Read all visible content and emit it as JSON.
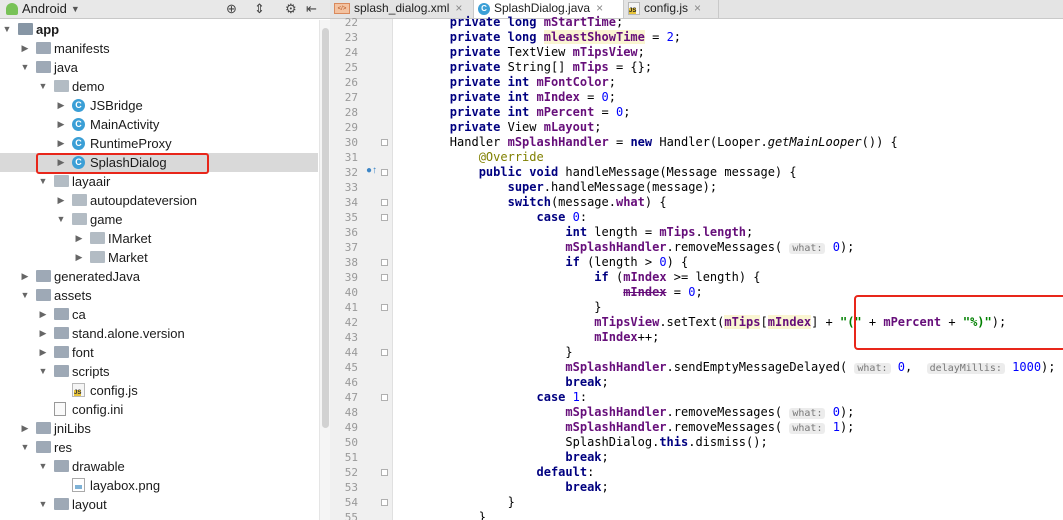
{
  "project_panel": {
    "view_selector": "Android",
    "tree": [
      {
        "label": "app",
        "depth": 0,
        "icon": "module-folder",
        "expanded": true,
        "bold": true
      },
      {
        "label": "manifests",
        "depth": 1,
        "icon": "folder",
        "expanded": false
      },
      {
        "label": "java",
        "depth": 1,
        "icon": "folder",
        "expanded": true
      },
      {
        "label": "demo",
        "depth": 2,
        "icon": "package",
        "expanded": true
      },
      {
        "label": "JSBridge",
        "depth": 3,
        "icon": "class",
        "expanded": false
      },
      {
        "label": "MainActivity",
        "depth": 3,
        "icon": "class",
        "expanded": false
      },
      {
        "label": "RuntimeProxy",
        "depth": 3,
        "icon": "class",
        "expanded": false
      },
      {
        "label": "SplashDialog",
        "depth": 3,
        "icon": "class",
        "expanded": false,
        "selected": true
      },
      {
        "label": "layaair",
        "depth": 2,
        "icon": "package",
        "expanded": true
      },
      {
        "label": "autoupdateversion",
        "depth": 3,
        "icon": "package",
        "expanded": false
      },
      {
        "label": "game",
        "depth": 3,
        "icon": "package",
        "expanded": true
      },
      {
        "label": "IMarket",
        "depth": 4,
        "icon": "package",
        "expanded": false
      },
      {
        "label": "Market",
        "depth": 4,
        "icon": "package",
        "expanded": false
      },
      {
        "label": "generatedJava",
        "depth": 1,
        "icon": "folder",
        "expanded": false
      },
      {
        "label": "assets",
        "depth": 1,
        "icon": "folder",
        "expanded": true
      },
      {
        "label": "ca",
        "depth": 2,
        "icon": "folder",
        "expanded": false
      },
      {
        "label": "stand.alone.version",
        "depth": 2,
        "icon": "folder",
        "expanded": false
      },
      {
        "label": "font",
        "depth": 2,
        "icon": "folder",
        "expanded": false
      },
      {
        "label": "scripts",
        "depth": 2,
        "icon": "folder",
        "expanded": true
      },
      {
        "label": "config.js",
        "depth": 3,
        "icon": "js-file",
        "leaf": true
      },
      {
        "label": "config.ini",
        "depth": 2,
        "icon": "ini-file",
        "leaf": true
      },
      {
        "label": "jniLibs",
        "depth": 1,
        "icon": "folder",
        "expanded": false
      },
      {
        "label": "res",
        "depth": 1,
        "icon": "folder",
        "expanded": true
      },
      {
        "label": "drawable",
        "depth": 2,
        "icon": "folder",
        "expanded": true
      },
      {
        "label": "layabox.png",
        "depth": 3,
        "icon": "png-file",
        "leaf": true
      },
      {
        "label": "layout",
        "depth": 2,
        "icon": "folder",
        "expanded": true
      }
    ]
  },
  "editor": {
    "tabs": [
      {
        "label": "splash_dialog.xml",
        "icon": "xml-icon",
        "active": false
      },
      {
        "label": "SplashDialog.java",
        "icon": "class-icon",
        "active": true
      },
      {
        "label": "config.js",
        "icon": "js-icon",
        "active": false
      }
    ],
    "lines": [
      {
        "n": "22",
        "tokens": [
          [
            "        ",
            ""
          ],
          [
            "private long ",
            "kw"
          ],
          [
            "mStartTime",
            "fld"
          ],
          [
            ";",
            ""
          ]
        ]
      },
      {
        "n": "23",
        "tokens": [
          [
            "        ",
            ""
          ],
          [
            "private long ",
            "kw"
          ],
          [
            "mleastShowTime",
            "fld hl"
          ],
          [
            " = ",
            ""
          ],
          [
            "2",
            "num"
          ],
          [
            ";",
            ""
          ]
        ]
      },
      {
        "n": "24",
        "tokens": [
          [
            "        ",
            ""
          ],
          [
            "private ",
            "kw"
          ],
          [
            "TextView ",
            ""
          ],
          [
            "mTipsView",
            "fld"
          ],
          [
            ";",
            ""
          ]
        ]
      },
      {
        "n": "25",
        "tokens": [
          [
            "        ",
            ""
          ],
          [
            "private ",
            "kw"
          ],
          [
            "String[] ",
            ""
          ],
          [
            "mTips",
            "fld"
          ],
          [
            " = {};",
            ""
          ]
        ]
      },
      {
        "n": "26",
        "tokens": [
          [
            "        ",
            ""
          ],
          [
            "private int ",
            "kw"
          ],
          [
            "mFontColor",
            "fld"
          ],
          [
            ";",
            ""
          ]
        ]
      },
      {
        "n": "27",
        "tokens": [
          [
            "        ",
            ""
          ],
          [
            "private int ",
            "kw"
          ],
          [
            "mIndex",
            "fld"
          ],
          [
            " = ",
            ""
          ],
          [
            "0",
            "num"
          ],
          [
            ";",
            ""
          ]
        ]
      },
      {
        "n": "28",
        "tokens": [
          [
            "        ",
            ""
          ],
          [
            "private int ",
            "kw"
          ],
          [
            "mPercent",
            "fld"
          ],
          [
            " = ",
            ""
          ],
          [
            "0",
            "num"
          ],
          [
            ";",
            ""
          ]
        ]
      },
      {
        "n": "29",
        "tokens": [
          [
            "        ",
            ""
          ],
          [
            "private ",
            "kw"
          ],
          [
            "View ",
            ""
          ],
          [
            "mLayout",
            "fld"
          ],
          [
            ";",
            ""
          ]
        ]
      },
      {
        "n": "30",
        "tokens": [
          [
            "        ",
            ""
          ],
          [
            "Handler ",
            ""
          ],
          [
            "mSplashHandler",
            "fld"
          ],
          [
            " = ",
            ""
          ],
          [
            "new ",
            "kw"
          ],
          [
            "Handler(Looper.",
            ""
          ],
          [
            "getMainLooper",
            "it"
          ],
          [
            "()) {",
            ""
          ]
        ]
      },
      {
        "n": "31",
        "tokens": [
          [
            "            ",
            ""
          ],
          [
            "@Override",
            "ann"
          ]
        ]
      },
      {
        "n": "32",
        "tokens": [
          [
            "            ",
            ""
          ],
          [
            "public void ",
            "kw"
          ],
          [
            "handleMessage(Message message) {",
            ""
          ]
        ]
      },
      {
        "n": "33",
        "tokens": [
          [
            "                ",
            ""
          ],
          [
            "super",
            "kw"
          ],
          [
            ".handleMessage(message);",
            ""
          ]
        ]
      },
      {
        "n": "34",
        "tokens": [
          [
            "                ",
            ""
          ],
          [
            "switch",
            "kw"
          ],
          [
            "(message.",
            ""
          ],
          [
            "what",
            "fld"
          ],
          [
            ") {",
            ""
          ]
        ]
      },
      {
        "n": "35",
        "tokens": [
          [
            "                    ",
            ""
          ],
          [
            "case ",
            "kw"
          ],
          [
            "0",
            "num"
          ],
          [
            ":",
            ""
          ]
        ]
      },
      {
        "n": "36",
        "tokens": [
          [
            "                        ",
            ""
          ],
          [
            "int ",
            "kw"
          ],
          [
            "length = ",
            ""
          ],
          [
            "mTips",
            "fld"
          ],
          [
            ".",
            ""
          ],
          [
            "length",
            "fld"
          ],
          [
            ";",
            ""
          ]
        ]
      },
      {
        "n": "37",
        "tokens": [
          [
            "                        ",
            ""
          ],
          [
            "mSplashHandler",
            "fld"
          ],
          [
            ".removeMessages( ",
            ""
          ],
          [
            "what:",
            "hint"
          ],
          [
            " ",
            ""
          ],
          [
            "0",
            "num"
          ],
          [
            ");",
            ""
          ]
        ]
      },
      {
        "n": "38",
        "tokens": [
          [
            "                        ",
            ""
          ],
          [
            "if ",
            "kw"
          ],
          [
            "(length > ",
            ""
          ],
          [
            "0",
            "num"
          ],
          [
            ") {",
            ""
          ]
        ]
      },
      {
        "n": "39",
        "tokens": [
          [
            "                            ",
            ""
          ],
          [
            "if ",
            "kw"
          ],
          [
            "(",
            ""
          ],
          [
            "mIndex",
            "fld"
          ],
          [
            " >= length) {",
            ""
          ]
        ]
      },
      {
        "n": "40",
        "tokens": [
          [
            "                                ",
            ""
          ],
          [
            "mIndex",
            "fld strike"
          ],
          [
            " = ",
            ""
          ],
          [
            "0",
            "num"
          ],
          [
            ";",
            ""
          ]
        ]
      },
      {
        "n": "41",
        "tokens": [
          [
            "                            ",
            ""
          ],
          [
            "}",
            ""
          ]
        ]
      },
      {
        "n": "42",
        "tokens": [
          [
            "                            ",
            ""
          ],
          [
            "mTipsView",
            "fld"
          ],
          [
            ".setText(",
            ""
          ],
          [
            "mTips",
            "fld hl"
          ],
          [
            "[",
            ""
          ],
          [
            "mIndex",
            "fld hl"
          ],
          [
            "] + ",
            ""
          ],
          [
            "\"(\"",
            "str"
          ],
          [
            " + ",
            ""
          ],
          [
            "mPercent",
            "fld"
          ],
          [
            " + ",
            ""
          ],
          [
            "\"%)\"",
            "str"
          ],
          [
            ");",
            ""
          ]
        ]
      },
      {
        "n": "43",
        "tokens": [
          [
            "                            ",
            ""
          ],
          [
            "mIndex",
            "fld"
          ],
          [
            "++;",
            ""
          ]
        ]
      },
      {
        "n": "44",
        "tokens": [
          [
            "                        ",
            ""
          ],
          [
            "}",
            ""
          ]
        ]
      },
      {
        "n": "45",
        "tokens": [
          [
            "                        ",
            ""
          ],
          [
            "mSplashHandler",
            "fld"
          ],
          [
            ".sendEmptyMessageDelayed( ",
            ""
          ],
          [
            "what:",
            "hint"
          ],
          [
            " ",
            ""
          ],
          [
            "0",
            "num"
          ],
          [
            ",  ",
            ""
          ],
          [
            "delayMillis:",
            "hint"
          ],
          [
            " ",
            ""
          ],
          [
            "1000",
            "num"
          ],
          [
            ");",
            ""
          ]
        ]
      },
      {
        "n": "46",
        "tokens": [
          [
            "                        ",
            ""
          ],
          [
            "break",
            "kw"
          ],
          [
            ";",
            ""
          ]
        ]
      },
      {
        "n": "47",
        "tokens": [
          [
            "                    ",
            ""
          ],
          [
            "case ",
            "kw"
          ],
          [
            "1",
            "num"
          ],
          [
            ":",
            ""
          ]
        ]
      },
      {
        "n": "48",
        "tokens": [
          [
            "                        ",
            ""
          ],
          [
            "mSplashHandler",
            "fld"
          ],
          [
            ".removeMessages( ",
            ""
          ],
          [
            "what:",
            "hint"
          ],
          [
            " ",
            ""
          ],
          [
            "0",
            "num"
          ],
          [
            ");",
            ""
          ]
        ]
      },
      {
        "n": "49",
        "tokens": [
          [
            "                        ",
            ""
          ],
          [
            "mSplashHandler",
            "fld"
          ],
          [
            ".removeMessages( ",
            ""
          ],
          [
            "what:",
            "hint"
          ],
          [
            " ",
            ""
          ],
          [
            "1",
            "num"
          ],
          [
            ");",
            ""
          ]
        ]
      },
      {
        "n": "50",
        "tokens": [
          [
            "                        ",
            ""
          ],
          [
            "SplashDialog.",
            ""
          ],
          [
            "this",
            "kw"
          ],
          [
            ".dismiss();",
            ""
          ]
        ]
      },
      {
        "n": "51",
        "tokens": [
          [
            "                        ",
            ""
          ],
          [
            "break",
            "kw"
          ],
          [
            ";",
            ""
          ]
        ]
      },
      {
        "n": "52",
        "tokens": [
          [
            "                    ",
            ""
          ],
          [
            "default",
            "kw"
          ],
          [
            ":",
            ""
          ]
        ]
      },
      {
        "n": "53",
        "tokens": [
          [
            "                        ",
            ""
          ],
          [
            "break",
            "kw"
          ],
          [
            ";",
            ""
          ]
        ]
      },
      {
        "n": "54",
        "tokens": [
          [
            "                ",
            ""
          ],
          [
            "}",
            ""
          ]
        ]
      },
      {
        "n": "55",
        "tokens": [
          [
            "            ",
            ""
          ],
          [
            "}",
            ""
          ]
        ]
      }
    ]
  },
  "colors": {
    "highlight_box": "#e8261a",
    "selection": "#d9d9d9",
    "keyword": "#000080",
    "field": "#660e7a",
    "number": "#0000ff",
    "string": "#008000"
  }
}
